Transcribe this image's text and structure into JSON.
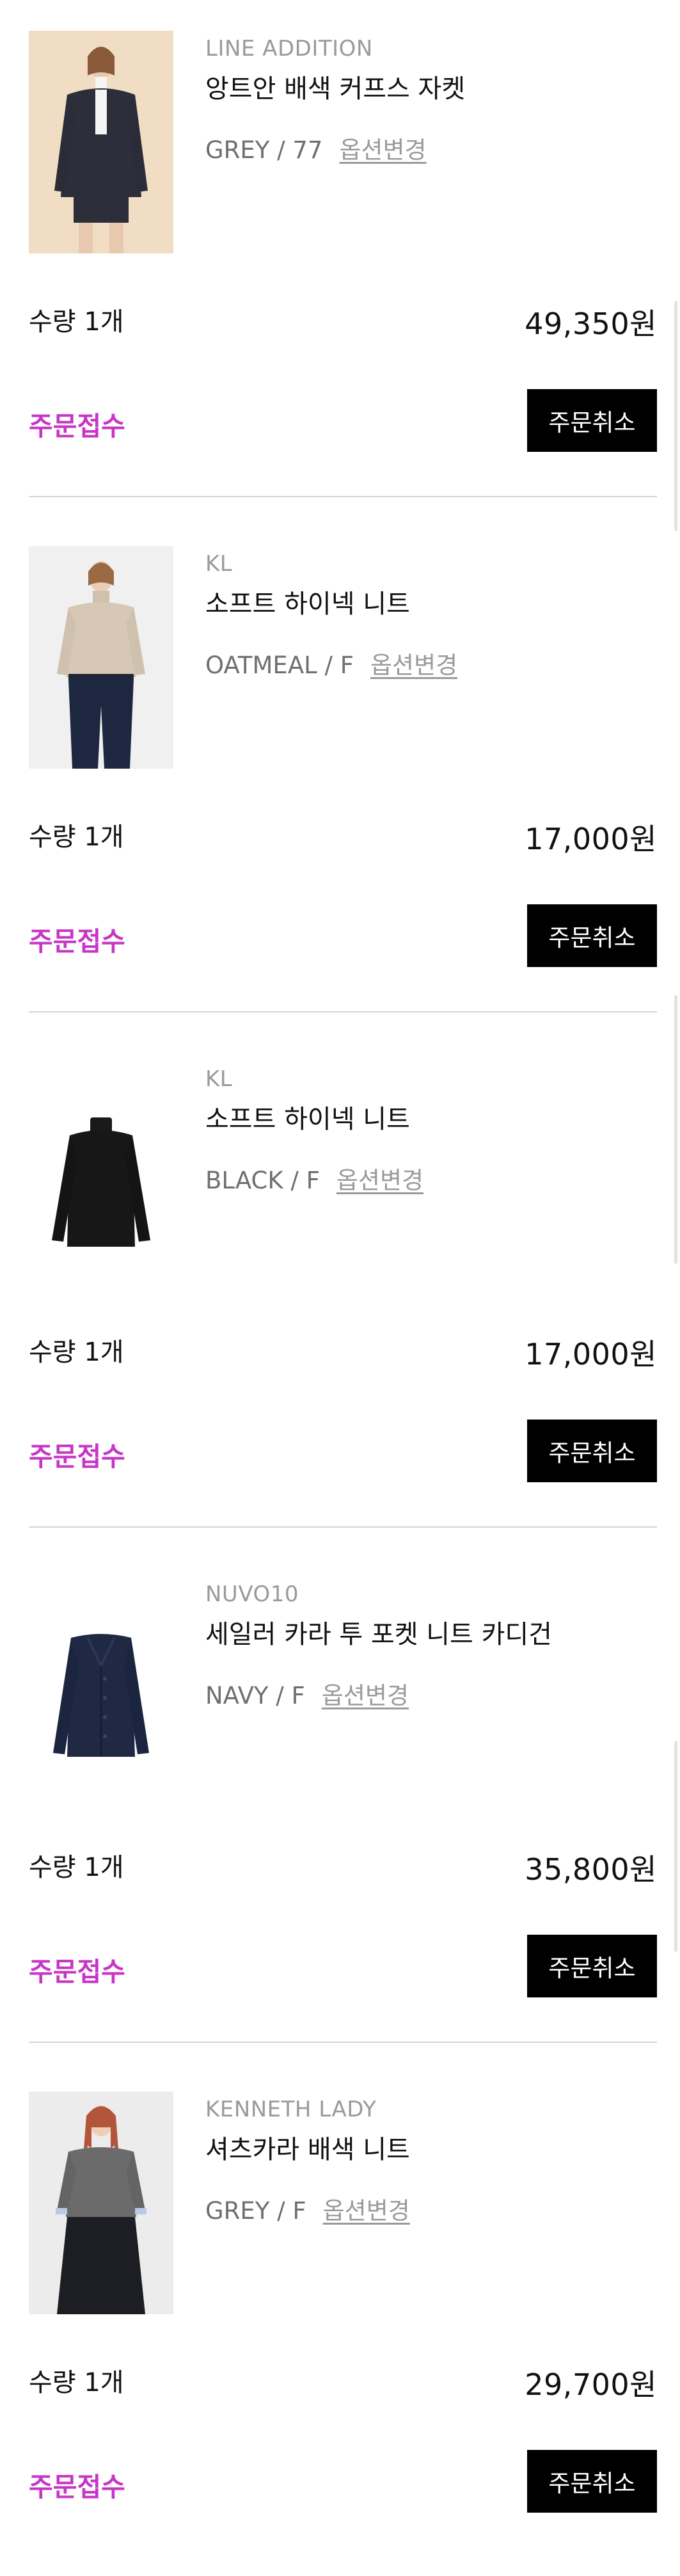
{
  "colors": {
    "status": "#c636c6",
    "button_bg": "#000000",
    "button_text": "#ffffff",
    "divider": "#d4d4d4",
    "brand_text": "#9a9a9a"
  },
  "orders": [
    {
      "brand": "LINE ADDITION",
      "name": "앙트안 배색 커프스 자켓",
      "option": "GREY / 77",
      "option_change": "옵션변경",
      "quantity": "수량 1개",
      "price": "49,350원",
      "status": "주문접수",
      "cancel_label": "주문취소",
      "image": "model-grey-jacket"
    },
    {
      "brand": "KL",
      "name": "소프트 하이넥 니트",
      "option": "OATMEAL / F",
      "option_change": "옵션변경",
      "quantity": "수량 1개",
      "price": "17,000원",
      "status": "주문접수",
      "cancel_label": "주문취소",
      "image": "model-oatmeal-knit"
    },
    {
      "brand": "KL",
      "name": "소프트 하이넥 니트",
      "option": "BLACK / F",
      "option_change": "옵션변경",
      "quantity": "수량 1개",
      "price": "17,000원",
      "status": "주문접수",
      "cancel_label": "주문취소",
      "image": "black-turtleneck-flat"
    },
    {
      "brand": "NUVO10",
      "name": "세일러 카라 투 포켓 니트 카디건",
      "option": "NAVY / F",
      "option_change": "옵션변경",
      "quantity": "수량 1개",
      "price": "35,800원",
      "status": "주문접수",
      "cancel_label": "주문취소",
      "image": "navy-cardigan-flat"
    },
    {
      "brand": "KENNETH LADY",
      "name": "셔츠카라 배색 니트",
      "option": "GREY / F",
      "option_change": "옵션변경",
      "quantity": "수량 1개",
      "price": "29,700원",
      "status": "주문접수",
      "cancel_label": "주문취소",
      "image": "model-grey-collar-knit"
    }
  ]
}
